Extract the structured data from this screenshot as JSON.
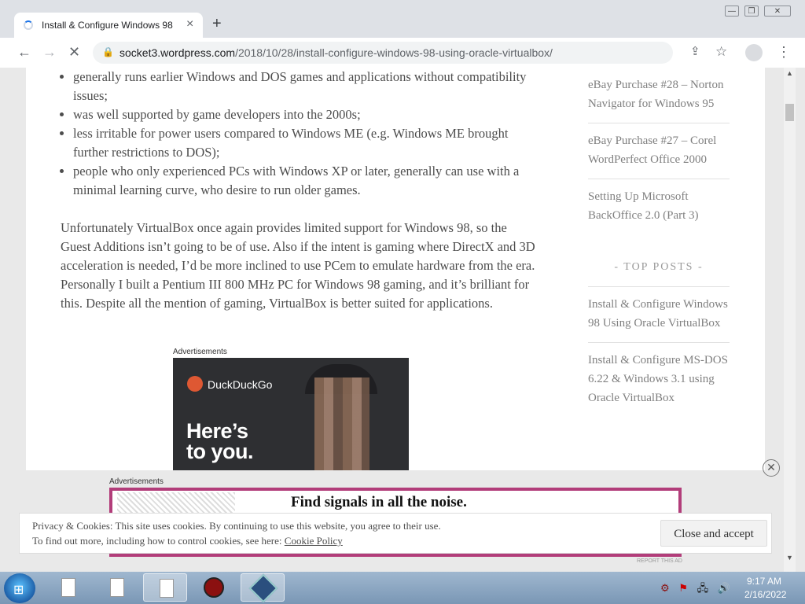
{
  "browser": {
    "tab_title": "Install & Configure Windows 98",
    "tab_close": "×",
    "new_tab": "+",
    "url_domain": "socket3.wordpress.com",
    "url_path": "/2018/10/28/install-configure-windows-98-using-oracle-virtualbox/",
    "window_controls": [
      "—",
      "❐",
      "✕"
    ]
  },
  "article": {
    "bullets": [
      "generally runs earlier Windows and DOS games and applications without compatibility issues;",
      "was well supported by game developers into the 2000s;",
      "less irritable for power users compared to Windows ME (e.g. Windows ME brought further restrictions to DOS);",
      "people who only experienced PCs with Windows XP or later, generally can use with a minimal learning curve, who desire to run older games."
    ],
    "paragraph": "Unfortunately VirtualBox once again provides limited support for Windows 98, so the Guest Additions isn’t going to be of use. Also if the intent is gaming where DirectX and 3D acceleration is needed, I’d be more inclined to use PCem to emulate hardware from the era. Personally I built a Pentium III 800 MHz PC for Windows 98 gaming, and it’s brilliant for this. Despite all the mention of gaming, VirtualBox is better suited for applications."
  },
  "ad1": {
    "label": "Advertisements",
    "brand": "DuckDuckGo",
    "headline_1": "Here’s",
    "headline_2": "to you."
  },
  "sidebar": {
    "recent_posts": [
      "eBay Purchase #28 – Norton Navigator for Windows 95",
      "eBay Purchase #27 – Corel WordPerfect Office 2000",
      "Setting Up Microsoft BackOffice 2.0 (Part 3)"
    ],
    "top_posts_heading": "- TOP POSTS -",
    "top_posts": [
      "Install & Configure Windows 98 Using Oracle VirtualBox",
      "Install & Configure MS-DOS 6.22 & Windows 3.1 using Oracle VirtualBox"
    ]
  },
  "ad2": {
    "label": "Advertisements",
    "headline": "Find signals in all the noise.",
    "report": "REPORT THIS AD"
  },
  "cookie": {
    "line1": "Privacy & Cookies: This site uses cookies. By continuing to use this website, you agree to their use.",
    "line2_prefix": "To find out more, including how to control cookies, see here: ",
    "link": "Cookie Policy",
    "button": "Close and accept"
  },
  "taskbar": {
    "time": "9:17 AM",
    "date": "2/16/2022"
  }
}
